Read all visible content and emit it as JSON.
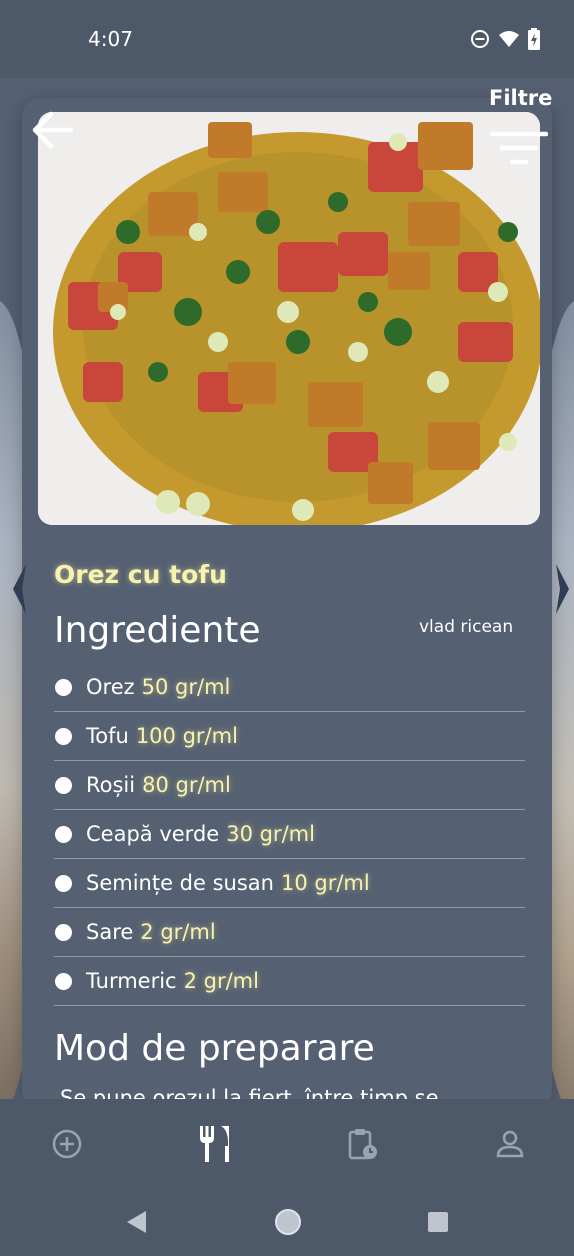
{
  "status_bar": {
    "time": "4:07",
    "icons": [
      "do-not-disturb-icon",
      "wifi-icon",
      "battery-charging-icon"
    ]
  },
  "header": {
    "back_icon": "arrow-left-icon",
    "filter_label": "Filtre",
    "filter_icon": "filter-lines-icon"
  },
  "recipe": {
    "title": "Orez cu tofu",
    "author": "vlad ricean",
    "image_description_icon": "food-photo",
    "ingredients_heading": "Ingrediente",
    "ingredients": [
      {
        "name": "Orez",
        "quantity": "50 gr/ml"
      },
      {
        "name": "Tofu",
        "quantity": "100 gr/ml"
      },
      {
        "name": "Roșii",
        "quantity": "80 gr/ml"
      },
      {
        "name": "Ceapă verde",
        "quantity": "30 gr/ml"
      },
      {
        "name": "Semințe de susan",
        "quantity": "10 gr/ml"
      },
      {
        "name": "Sare",
        "quantity": "2 gr/ml"
      },
      {
        "name": "Turmeric",
        "quantity": "2 gr/ml"
      }
    ],
    "method_heading": "Mod de preparare",
    "method_text": "Se pune orezul la fiert, între timp se"
  },
  "carousel": {
    "prev_icon": "chevron-left-icon",
    "next_icon": "chevron-right-icon"
  },
  "bottom_nav": {
    "tabs": [
      {
        "icon": "add-circle-icon",
        "active": false
      },
      {
        "icon": "fork-knife-icon",
        "active": true
      },
      {
        "icon": "clipboard-clock-icon",
        "active": false
      },
      {
        "icon": "person-icon",
        "active": false
      }
    ]
  },
  "system_nav": [
    "back-triangle-icon",
    "home-circle-icon",
    "recents-square-icon"
  ],
  "colors": {
    "background": "#556072",
    "bars": "#4d5869",
    "highlight_text": "#f7f2b0",
    "text": "#ffffff",
    "divider": "#8f99a8"
  }
}
